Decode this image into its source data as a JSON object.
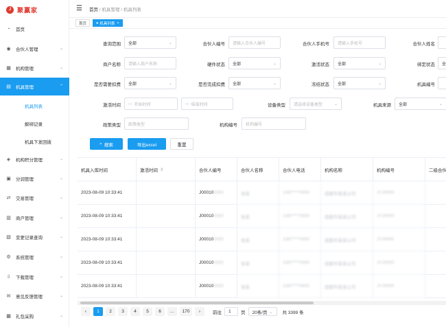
{
  "app": {
    "logo_text": "聚赢家",
    "logo_mark": "J"
  },
  "sidebar": {
    "items": [
      {
        "label": "首页",
        "icon": "dashboard-icon"
      },
      {
        "label": "合伙人管理",
        "icon": "user-icon"
      },
      {
        "label": "机构管理",
        "icon": "institution-icon"
      },
      {
        "label": "机具管理",
        "icon": "device-icon"
      },
      {
        "label": "机构积分管理",
        "icon": "points-icon"
      },
      {
        "label": "分润管理",
        "icon": "profit-icon"
      },
      {
        "label": "交易管理",
        "icon": "transaction-icon"
      },
      {
        "label": "商户管理",
        "icon": "merchant-icon"
      },
      {
        "label": "变更记录查询",
        "icon": "record-icon"
      },
      {
        "label": "系统管理",
        "icon": "settings-icon"
      },
      {
        "label": "下载管理",
        "icon": "download-icon"
      },
      {
        "label": "意见反馈管理",
        "icon": "feedback-icon"
      },
      {
        "label": "礼包采购",
        "icon": "gift-icon"
      }
    ],
    "sub_items": [
      "机具列表",
      "解绑记录",
      "机具下发回拨"
    ]
  },
  "topbar": {
    "crumbs": [
      "首页",
      "机具管理",
      "机具列表"
    ],
    "sep": "/"
  },
  "tabs": [
    {
      "label": "首页"
    },
    {
      "label": "机具列表"
    }
  ],
  "filters": {
    "query_scope": {
      "label": "查询范围",
      "value": "全部"
    },
    "partner_no": {
      "label": "合伙人编号",
      "placeholder": "请输入合伙人编号"
    },
    "partner_phone": {
      "label": "合伙人手机号",
      "placeholder": "请输入手机号"
    },
    "partner_name": {
      "label": "合伙人姓名"
    },
    "merchant_name": {
      "label": "商户名称",
      "placeholder": "请输入商户名称"
    },
    "hardware_status": {
      "label": "硬件状态",
      "value": "全部"
    },
    "activation_status": {
      "label": "激活状态",
      "value": "全部"
    },
    "bind_status": {
      "label": "绑定状态",
      "value": "全部"
    },
    "need_deduct": {
      "label": "是否需要扣费",
      "value": "全部"
    },
    "deducted": {
      "label": "是否完成扣费",
      "value": "全部"
    },
    "frozen_status": {
      "label": "冻结状态",
      "value": "全部"
    },
    "device_no": {
      "label": "机具编号"
    },
    "activation_time": {
      "label": "激活时间",
      "start": "开始时间",
      "end": "结束时间"
    },
    "device_type": {
      "label": "设备类型",
      "placeholder": "请选择设备类型"
    },
    "device_source": {
      "label": "机具来源",
      "value": "全部"
    },
    "policy_type": {
      "label": "政策类型",
      "placeholder": "政策类型"
    },
    "org_no": {
      "label": "机构编号",
      "placeholder": "机构编号"
    }
  },
  "buttons": {
    "search": "搜索",
    "export": "导出excel",
    "reset": "重置"
  },
  "table": {
    "headers": [
      "机具入库时间",
      "激活时间",
      "合伙人编号",
      "合伙人名称",
      "合伙人电话",
      "机构名称",
      "机构编号",
      "二级合伙人"
    ],
    "rows": [
      {
        "in_time": "2023-08-09 10:33:41",
        "partner_no": "J00010",
        "partner_no_tail": "0000",
        "name": "张某",
        "phone": "1387****0000",
        "org": "成都市某某公司",
        "org_no": "JYJ0000"
      },
      {
        "in_time": "2023-08-09 10:33:41",
        "partner_no": "J00010",
        "partner_no_tail": "0000",
        "name": "张某",
        "phone": "1387****0000",
        "org": "成都市某某公司",
        "org_no": "JYJ0000"
      },
      {
        "in_time": "2023-08-09 10:33:41",
        "partner_no": "J00010",
        "partner_no_tail": "0000",
        "name": "张某",
        "phone": "1387****0000",
        "org": "成都市某某公司",
        "org_no": "JYJ0000"
      },
      {
        "in_time": "2023-08-09 10:33:41",
        "partner_no": "J00010",
        "partner_no_tail": "0000",
        "name": "张某",
        "phone": "1387****0000",
        "org": "成都市某某公司",
        "org_no": "JYJ0000"
      },
      {
        "in_time": "2023-08-09 10:33:41",
        "partner_no": "J00010",
        "partner_no_tail": "0000",
        "name": "张某",
        "phone": "1387****0000",
        "org": "成都市某某公司",
        "org_no": "JYJ0000"
      }
    ]
  },
  "pager": {
    "pages": [
      "1",
      "2",
      "3",
      "4",
      "5",
      "6",
      "…",
      "170"
    ],
    "goto_prefix": "前往",
    "goto_value": "1",
    "goto_suffix": "页",
    "page_size": "20条/页",
    "total": "共 3399 条",
    "prev": "‹",
    "next": "›"
  }
}
